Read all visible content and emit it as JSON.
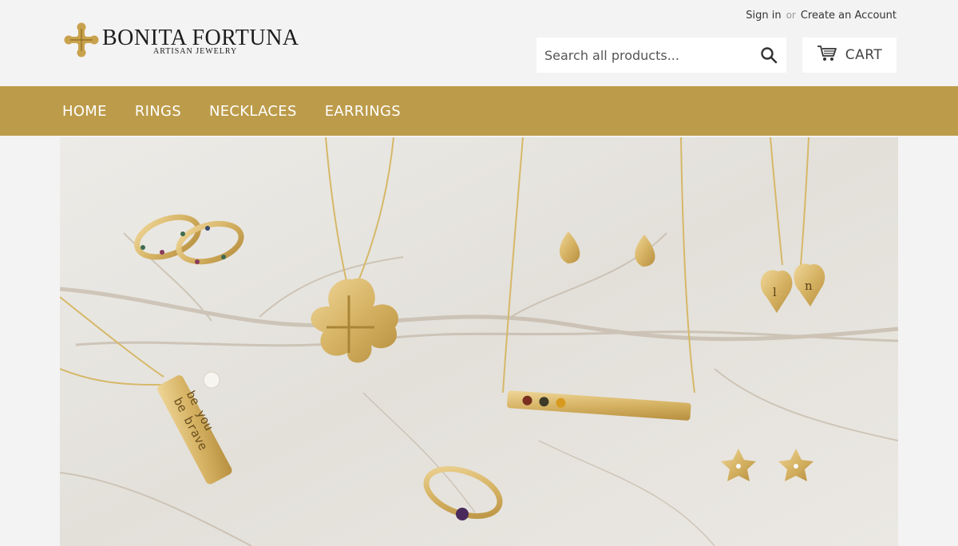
{
  "brand": {
    "name": "BONITA FORTUNA",
    "tagline": "ARTISAN JEWELRY",
    "color": "#bc9b4a"
  },
  "account": {
    "sign_in": "Sign in",
    "or": "or",
    "create_account": "Create an Account"
  },
  "search": {
    "placeholder": "Search all products...",
    "icon": "search-icon"
  },
  "cart": {
    "label": "CART",
    "icon": "cart-icon"
  },
  "nav": {
    "items": [
      {
        "label": "HOME"
      },
      {
        "label": "RINGS"
      },
      {
        "label": "NECKLACES"
      },
      {
        "label": "EARRINGS"
      }
    ]
  },
  "hero": {
    "engraving_line1": "be brave",
    "engraving_line2": "be you",
    "heart_initial_1": "l",
    "heart_initial_2": "n"
  },
  "colors": {
    "nav_bg": "#bc9b4a",
    "page_bg": "#f3f3f3",
    "gold": "#d9b867"
  }
}
